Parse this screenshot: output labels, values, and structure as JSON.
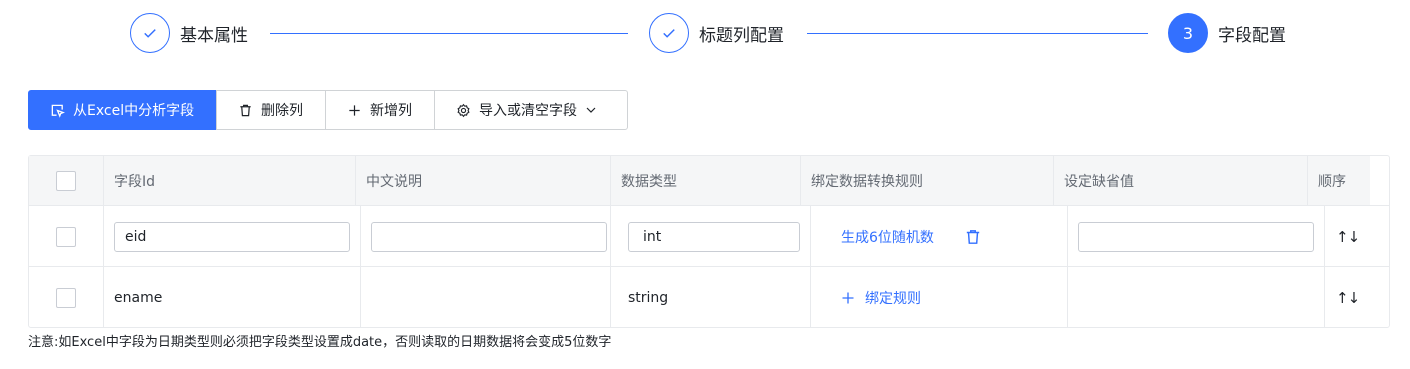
{
  "steps": [
    {
      "label": "基本属性",
      "state": "done"
    },
    {
      "label": "标题列配置",
      "state": "done"
    },
    {
      "label": "字段配置",
      "state": "active",
      "number": "3"
    }
  ],
  "toolbar": {
    "analyze_label": "从Excel中分析字段",
    "delete_label": "删除列",
    "add_label": "新增列",
    "import_label": "导入或清空字段"
  },
  "table": {
    "headers": [
      "字段Id",
      "中文说明",
      "数据类型",
      "绑定数据转换规则",
      "设定缺省值",
      "顺序"
    ],
    "rows": [
      {
        "field_id": "eid",
        "description": "",
        "data_type": "int",
        "rule": "生成6位随机数",
        "default": "",
        "order": "↑↓"
      },
      {
        "field_id": "ename",
        "description": "",
        "data_type": "string",
        "rule": "绑定规则",
        "default": "",
        "order": "↑↓"
      }
    ]
  },
  "note": "注意:如Excel中字段为日期类型则必须把字段类型设置成date，否则读取的日期数据将会变成5位数字",
  "colors": {
    "accent": "#3370ff",
    "border": "#e8eaed",
    "header_bg": "#f5f6f7"
  }
}
